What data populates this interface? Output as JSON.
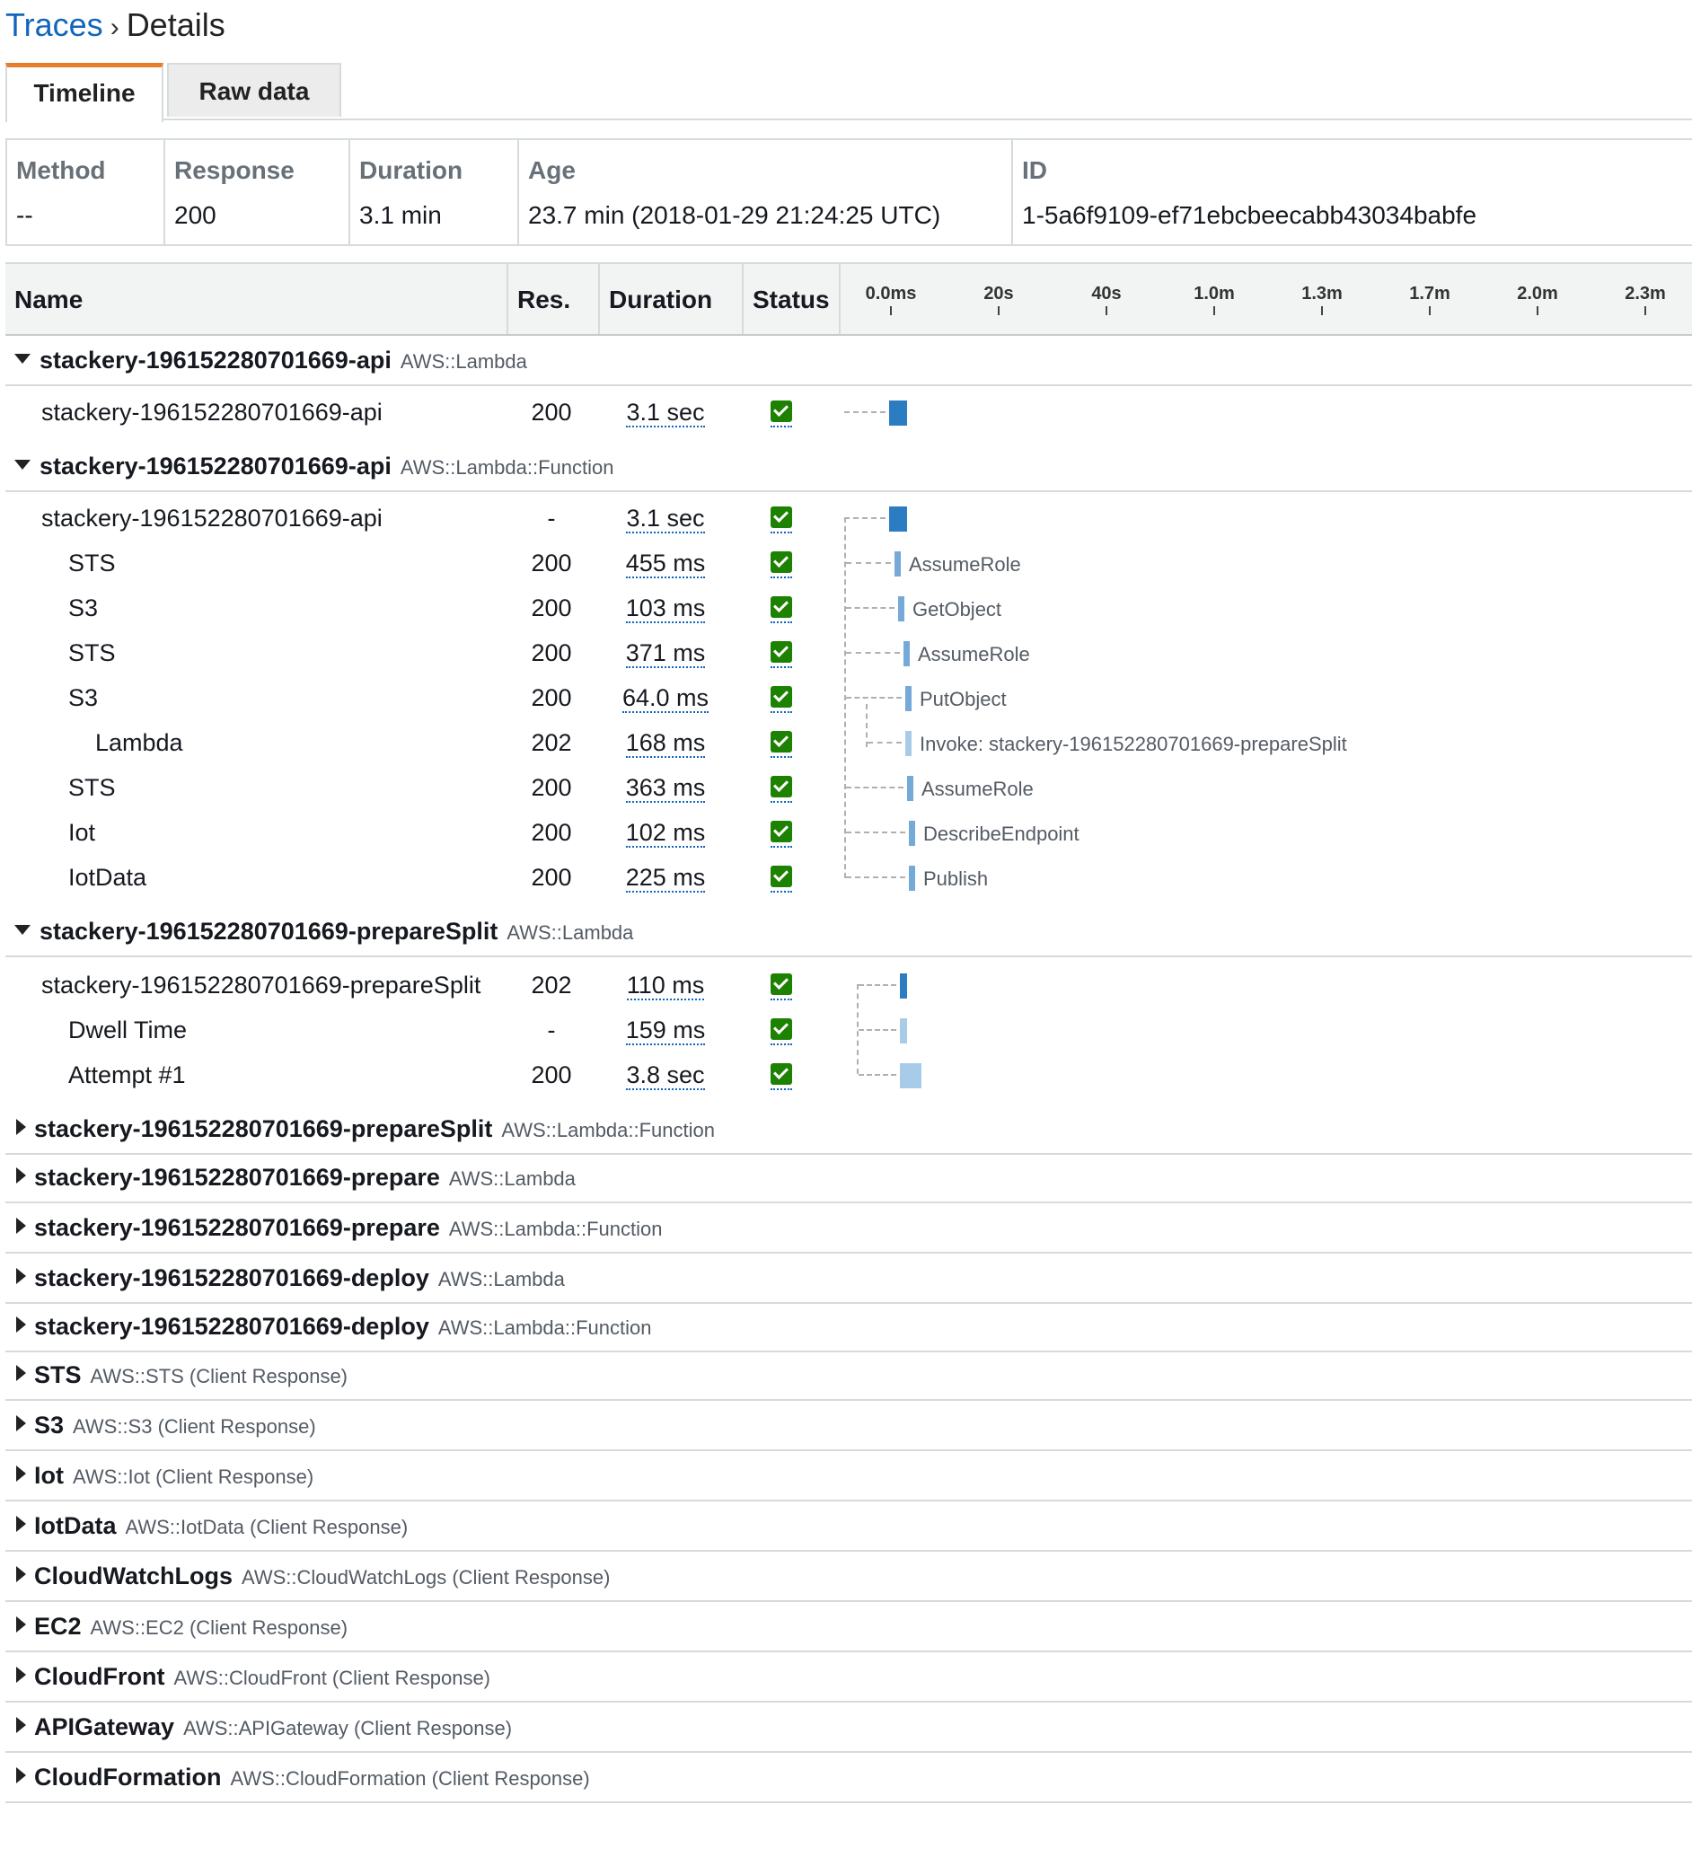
{
  "breadcrumb": {
    "link": "Traces",
    "separator": "›",
    "current": "Details"
  },
  "tabs": [
    {
      "label": "Timeline",
      "active": true
    },
    {
      "label": "Raw data",
      "active": false
    }
  ],
  "summary": {
    "method": {
      "label": "Method",
      "value": "--"
    },
    "response": {
      "label": "Response",
      "value": "200"
    },
    "duration": {
      "label": "Duration",
      "value": "3.1 min"
    },
    "age": {
      "label": "Age",
      "value": "23.7 min (2018-01-29 21:24:25 UTC)"
    },
    "id": {
      "label": "ID",
      "value": "1-5a6f9109-ef71ebcbeecabb43034babfe"
    }
  },
  "table": {
    "headers": {
      "name": "Name",
      "res": "Res.",
      "duration": "Duration",
      "status": "Status"
    },
    "ticks": [
      "0.0ms",
      "20s",
      "40s",
      "1.0m",
      "1.3m",
      "1.7m",
      "2.0m",
      "2.3m"
    ]
  },
  "expanded_groups": [
    {
      "title": "stackery-196152280701669-api",
      "type": "AWS::Lambda",
      "rows": [
        {
          "name": "stackery-196152280701669-api",
          "res": "200",
          "duration": "3.1 sec",
          "label": ""
        }
      ]
    },
    {
      "title": "stackery-196152280701669-api",
      "type": "AWS::Lambda::Function",
      "rows": [
        {
          "name": "stackery-196152280701669-api",
          "res": "-",
          "duration": "3.1 sec",
          "label": ""
        },
        {
          "name": "STS",
          "res": "200",
          "duration": "455 ms",
          "label": "AssumeRole"
        },
        {
          "name": "S3",
          "res": "200",
          "duration": "103 ms",
          "label": "GetObject"
        },
        {
          "name": "STS",
          "res": "200",
          "duration": "371 ms",
          "label": "AssumeRole"
        },
        {
          "name": "S3",
          "res": "200",
          "duration": "64.0 ms",
          "label": "PutObject"
        },
        {
          "name": "Lambda",
          "res": "202",
          "duration": "168 ms",
          "label": "Invoke: stackery-196152280701669-prepareSplit"
        },
        {
          "name": "STS",
          "res": "200",
          "duration": "363 ms",
          "label": "AssumeRole"
        },
        {
          "name": "Iot",
          "res": "200",
          "duration": "102 ms",
          "label": "DescribeEndpoint"
        },
        {
          "name": "IotData",
          "res": "200",
          "duration": "225 ms",
          "label": "Publish"
        }
      ]
    },
    {
      "title": "stackery-196152280701669-prepareSplit",
      "type": "AWS::Lambda",
      "rows": [
        {
          "name": "stackery-196152280701669-prepareSplit",
          "res": "202",
          "duration": "110 ms",
          "label": ""
        },
        {
          "name": "Dwell Time",
          "res": "-",
          "duration": "159 ms",
          "label": ""
        },
        {
          "name": "Attempt #1",
          "res": "200",
          "duration": "3.8 sec",
          "label": ""
        }
      ]
    }
  ],
  "collapsed_groups": [
    {
      "title": "stackery-196152280701669-prepareSplit",
      "type": "AWS::Lambda::Function"
    },
    {
      "title": "stackery-196152280701669-prepare",
      "type": "AWS::Lambda"
    },
    {
      "title": "stackery-196152280701669-prepare",
      "type": "AWS::Lambda::Function"
    },
    {
      "title": "stackery-196152280701669-deploy",
      "type": "AWS::Lambda"
    },
    {
      "title": "stackery-196152280701669-deploy",
      "type": "AWS::Lambda::Function"
    },
    {
      "title": "STS",
      "type": "AWS::STS (Client Response)"
    },
    {
      "title": "S3",
      "type": "AWS::S3 (Client Response)"
    },
    {
      "title": "Iot",
      "type": "AWS::Iot (Client Response)"
    },
    {
      "title": "IotData",
      "type": "AWS::IotData (Client Response)"
    },
    {
      "title": "CloudWatchLogs",
      "type": "AWS::CloudWatchLogs (Client Response)"
    },
    {
      "title": "EC2",
      "type": "AWS::EC2 (Client Response)"
    },
    {
      "title": "CloudFront",
      "type": "AWS::CloudFront (Client Response)"
    },
    {
      "title": "APIGateway",
      "type": "AWS::APIGateway (Client Response)"
    },
    {
      "title": "CloudFormation",
      "type": "AWS::CloudFormation (Client Response)"
    }
  ],
  "colors": {
    "link": "#1166bb",
    "tab_accent": "#e77e2d",
    "status_ok": "#1d8102",
    "bar_dark": "#2c7cc2",
    "bar_mid": "#74a9d8",
    "bar_light": "#a9cbea"
  },
  "icons": {
    "status": "check-square-icon",
    "expand": "caret-down-icon",
    "collapse": "caret-right-icon"
  }
}
